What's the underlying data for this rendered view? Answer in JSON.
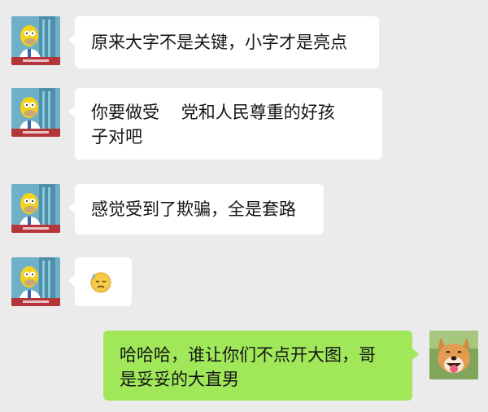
{
  "chat": {
    "messages": [
      {
        "side": "left",
        "text": "原来大字不是关键，小字才是亮点"
      },
      {
        "side": "left",
        "text": "你要做受    党和人民尊重的好孩\n子对吧"
      },
      {
        "side": "left",
        "text": "感觉受到了欺骗，全是套路"
      },
      {
        "side": "left",
        "emoji": "😓"
      },
      {
        "side": "right",
        "text": "哈哈哈，谁让你们不点开大图，哥\n是妥妥的大直男"
      }
    ]
  },
  "colors": {
    "background": "#ebebeb",
    "incoming_bubble": "#ffffff",
    "outgoing_bubble": "#a0e75a"
  },
  "icons": {
    "sender_avatar": "cartoon-man-avatar-icon",
    "self_avatar": "smiling-dog-avatar-icon",
    "emoji": "cold-sweat-emoji-icon"
  }
}
